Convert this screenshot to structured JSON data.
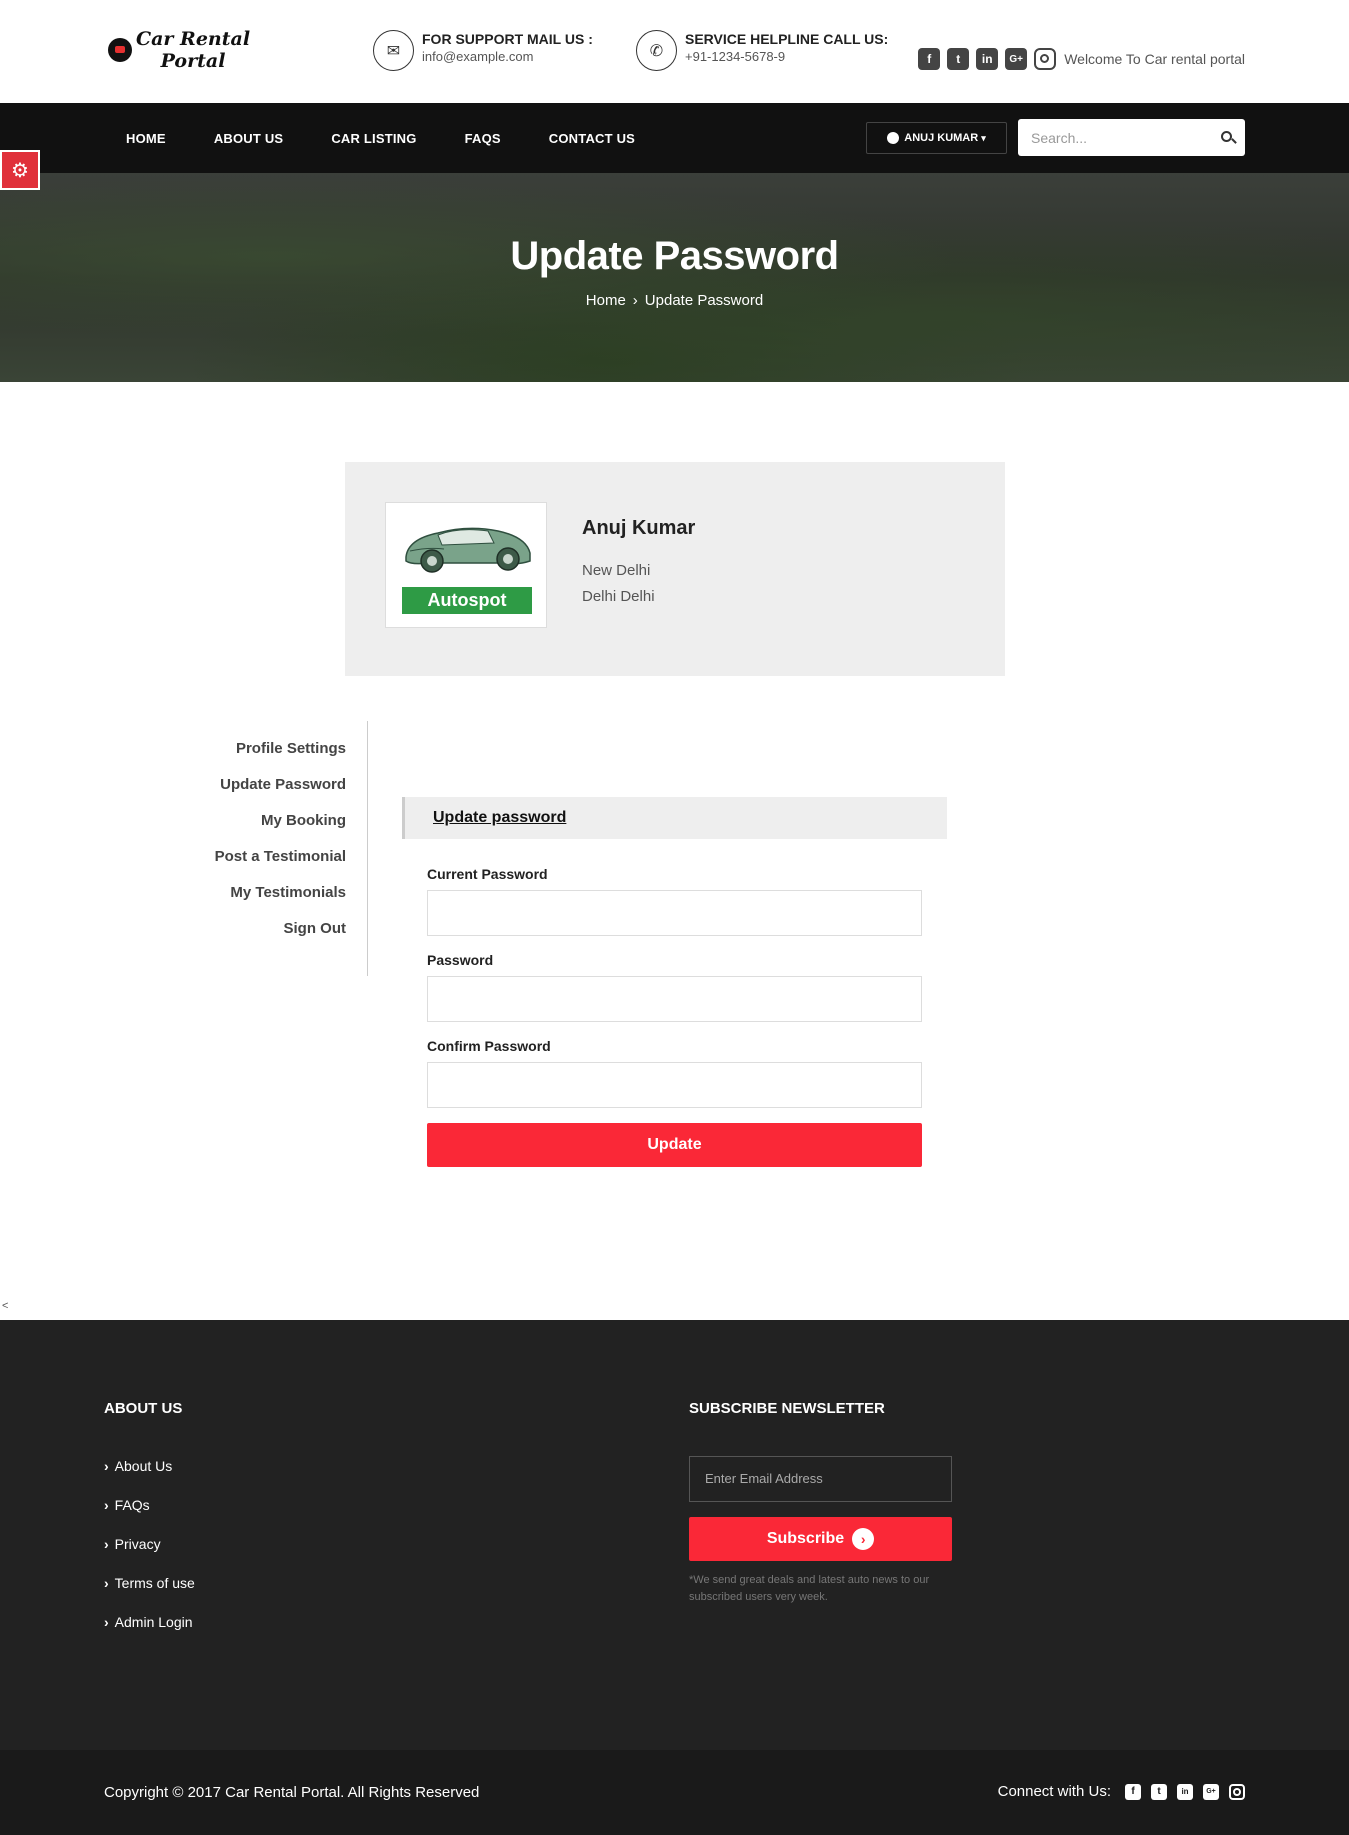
{
  "header": {
    "logo_line1": "Car Rental",
    "logo_line2": "Portal",
    "support_title": "FOR SUPPORT MAIL US :",
    "support_email": "info@example.com",
    "helpline_title": "SERVICE HELPLINE CALL US:",
    "helpline_phone": "+91-1234-5678-9",
    "welcome": "Welcome To Car rental portal",
    "social_icons": [
      "facebook-icon",
      "twitter-icon",
      "linkedin-icon",
      "google-plus-icon",
      "instagram-icon"
    ]
  },
  "nav": {
    "items": [
      "HOME",
      "ABOUT US",
      "CAR LISTING",
      "FAQS",
      "CONTACT US"
    ],
    "user": "ANUJ KUMAR",
    "search_placeholder": "Search..."
  },
  "hero": {
    "title": "Update Password",
    "crumb_home": "Home",
    "crumb_current": "Update Password"
  },
  "profile": {
    "photo_label": "Autospot",
    "name": "Anuj Kumar",
    "city": "New Delhi",
    "state": "Delhi Delhi"
  },
  "sidebar": {
    "items": [
      "Profile Settings",
      "Update Password",
      "My Booking",
      "Post a Testimonial",
      "My Testimonials",
      "Sign Out"
    ]
  },
  "form": {
    "heading": "Update password",
    "current_label": "Current Password",
    "password_label": "Password",
    "confirm_label": "Confirm Password",
    "submit": "Update"
  },
  "stray": "<",
  "footer": {
    "about_title": "ABOUT US",
    "links": [
      "About Us",
      "FAQs",
      "Privacy",
      "Terms of use",
      "Admin Login"
    ],
    "newsletter_title": "SUBSCRIBE NEWSLETTER",
    "email_placeholder": "Enter Email Address",
    "subscribe": "Subscribe",
    "note": "*We send great deals and latest auto news to our subscribed users very week.",
    "copyright": "Copyright © 2017 Car Rental Portal. All Rights Reserved",
    "connect": "Connect with Us:"
  },
  "colors": {
    "accent": "#fa2837",
    "nav_bg": "#111111",
    "footer_bg": "#222222"
  }
}
